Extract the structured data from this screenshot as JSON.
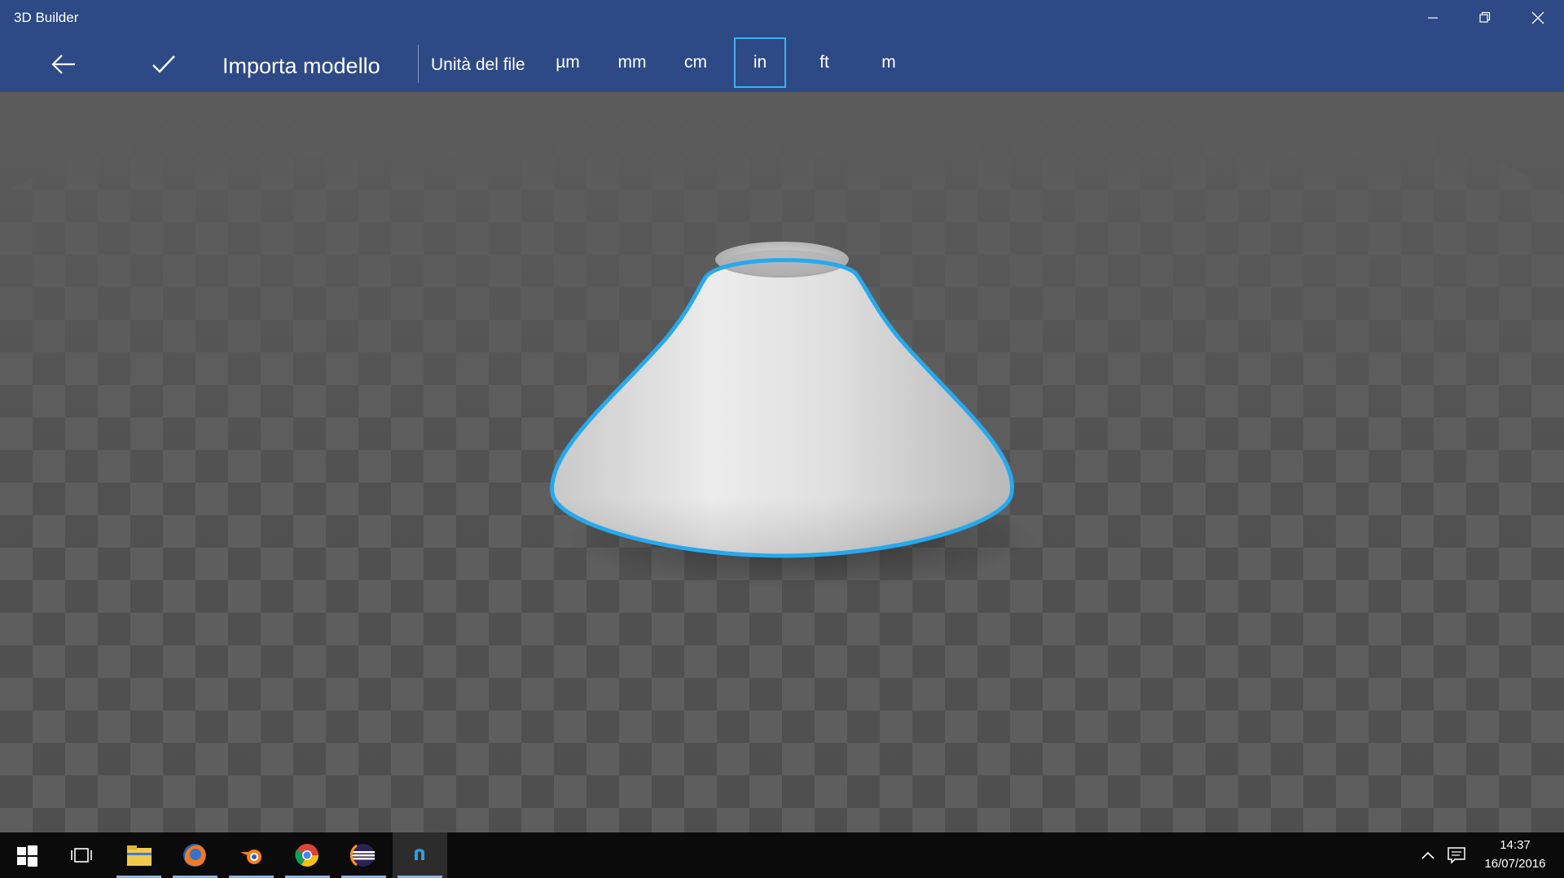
{
  "window": {
    "title": "3D Builder",
    "buttons": [
      "minimize-icon",
      "restore-icon",
      "close-icon"
    ]
  },
  "command_bar": {
    "back_icon": "back-arrow-icon",
    "confirm_icon": "checkmark-icon",
    "mode_title": "Importa modello",
    "units_label": "Unità del file",
    "units": [
      {
        "label": "µm",
        "selected": false
      },
      {
        "label": "mm",
        "selected": false
      },
      {
        "label": "cm",
        "selected": false
      },
      {
        "label": "in",
        "selected": true
      },
      {
        "label": "ft",
        "selected": false
      },
      {
        "label": "m",
        "selected": false
      }
    ],
    "selection_color": "#3fb1ec"
  },
  "viewport": {
    "floor": "checkerboard-grid",
    "model": "cone-vase",
    "model_selected": true,
    "outline_color": "#26a9ee"
  },
  "taskbar": {
    "apps": [
      "windows-start-icon",
      "task-view-icon",
      "file-explorer-icon",
      "firefox-icon",
      "blender-icon",
      "chrome-icon",
      "eclipse-icon",
      "3d-builder-icon"
    ],
    "time": "14:37",
    "date": "16/07/2016"
  },
  "colors": {
    "title_bar": "#2d4a86",
    "taskbar": "#0b0b0b",
    "floor_dark": "#4f4f4f",
    "floor_light": "#5e5e5e"
  }
}
